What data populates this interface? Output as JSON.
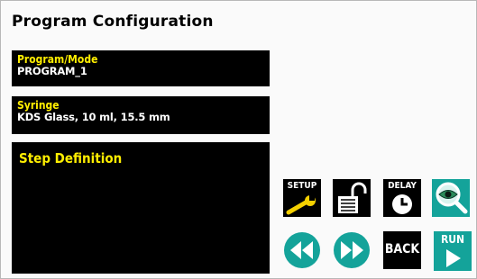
{
  "screen": {
    "title": "Program Configuration"
  },
  "program_mode": {
    "label": "Program/Mode",
    "value": "PROGRAM_1"
  },
  "syringe": {
    "label": "Syringe",
    "value": "KDS Glass, 10 ml, 15.5 mm"
  },
  "step_definition": {
    "label": "Step Definition"
  },
  "buttons": {
    "setup_label": "SETUP",
    "delay_label": "DELAY",
    "back_label": "BACK",
    "run_label": "RUN",
    "lock_icon": "unlocked-padlock-icon",
    "view_icon": "eye-magnifier-icon",
    "rewind_icon": "rewind-icon",
    "forward_icon": "fast-forward-icon"
  },
  "colors": {
    "panel": "#000000",
    "label": "#ffee00",
    "accent": "#14a39a",
    "wrench": "#f4d000"
  }
}
